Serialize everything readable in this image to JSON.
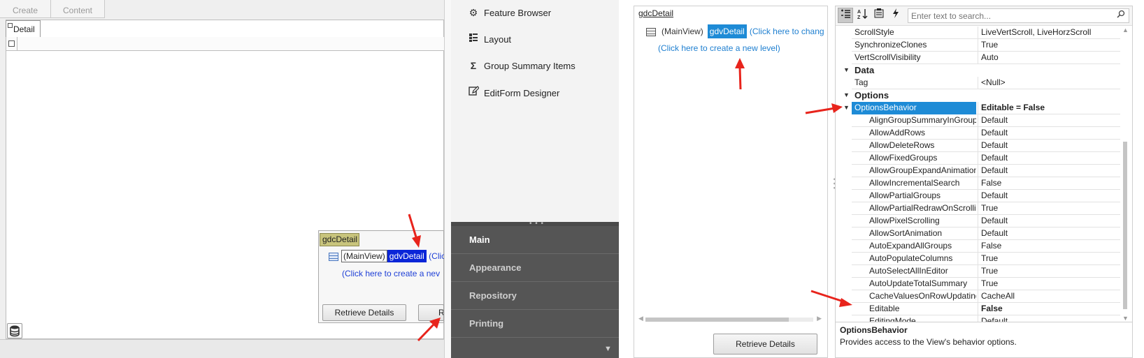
{
  "left": {
    "top_tabs": [
      "Create",
      "Content"
    ],
    "detail_tab": "Detail",
    "mini_designer": {
      "gdc_label": "gdcDetail",
      "mainview": "(MainView)",
      "gdv": "gdvDetail",
      "click_text": "(Clic",
      "create_level": "(Click here to create a nev",
      "retrieve_button": "Retrieve Details",
      "second_button": "R"
    }
  },
  "nav": {
    "items": [
      {
        "icon": "gear-icon",
        "label": "Feature Browser"
      },
      {
        "icon": "layout-icon",
        "label": "Layout"
      },
      {
        "icon": "sigma-icon",
        "label": "Group Summary Items"
      },
      {
        "icon": "edit-form-icon",
        "label": "EditForm Designer"
      }
    ],
    "groups": [
      "Main",
      "Appearance",
      "Repository",
      "Printing"
    ]
  },
  "level_designer": {
    "gdc_label": "gdcDetail",
    "mainview": "(MainView)",
    "gdv": "gdvDetail",
    "click_text": "(Click here to chang",
    "create_level": "(Click here to create a new level)",
    "retrieve_button": "Retrieve Details"
  },
  "property_grid": {
    "search_placeholder": "Enter text to search...",
    "rows": [
      {
        "type": "prop",
        "name": "ScrollStyle",
        "value": "LiveVertScroll, LiveHorzScroll"
      },
      {
        "type": "prop",
        "name": "SynchronizeClones",
        "value": "True"
      },
      {
        "type": "prop",
        "name": "VertScrollVisibility",
        "value": "Auto"
      },
      {
        "type": "category",
        "name": "Data"
      },
      {
        "type": "prop",
        "name": "Tag",
        "value": "<Null>"
      },
      {
        "type": "category",
        "name": "Options"
      },
      {
        "type": "selected",
        "name": "OptionsBehavior",
        "value": "Editable = False"
      },
      {
        "type": "sub",
        "name": "AlignGroupSummaryInGroupRow",
        "value": "Default"
      },
      {
        "type": "sub",
        "name": "AllowAddRows",
        "value": "Default"
      },
      {
        "type": "sub",
        "name": "AllowDeleteRows",
        "value": "Default"
      },
      {
        "type": "sub",
        "name": "AllowFixedGroups",
        "value": "Default"
      },
      {
        "type": "sub",
        "name": "AllowGroupExpandAnimation",
        "value": "Default"
      },
      {
        "type": "sub",
        "name": "AllowIncrementalSearch",
        "value": "False"
      },
      {
        "type": "sub",
        "name": "AllowPartialGroups",
        "value": "Default"
      },
      {
        "type": "sub",
        "name": "AllowPartialRedrawOnScrolling",
        "value": "True"
      },
      {
        "type": "sub",
        "name": "AllowPixelScrolling",
        "value": "Default"
      },
      {
        "type": "sub",
        "name": "AllowSortAnimation",
        "value": "Default"
      },
      {
        "type": "sub",
        "name": "AutoExpandAllGroups",
        "value": "False"
      },
      {
        "type": "sub",
        "name": "AutoPopulateColumns",
        "value": "True"
      },
      {
        "type": "sub",
        "name": "AutoSelectAllInEditor",
        "value": "True"
      },
      {
        "type": "sub",
        "name": "AutoUpdateTotalSummary",
        "value": "True"
      },
      {
        "type": "sub",
        "name": "CacheValuesOnRowUpdating",
        "value": "CacheAll"
      },
      {
        "type": "sub-bold",
        "name": "Editable",
        "value": "False"
      },
      {
        "type": "sub",
        "name": "EditingMode",
        "value": "Default"
      }
    ],
    "description_title": "OptionsBehavior",
    "description_text": "Provides access to the View's behavior options."
  },
  "colors": {
    "selection": "#1e8bd6",
    "nav_group_bg": "#555555",
    "arrow": "#e8241c",
    "gdc_label_bg": "#c8c47c"
  }
}
